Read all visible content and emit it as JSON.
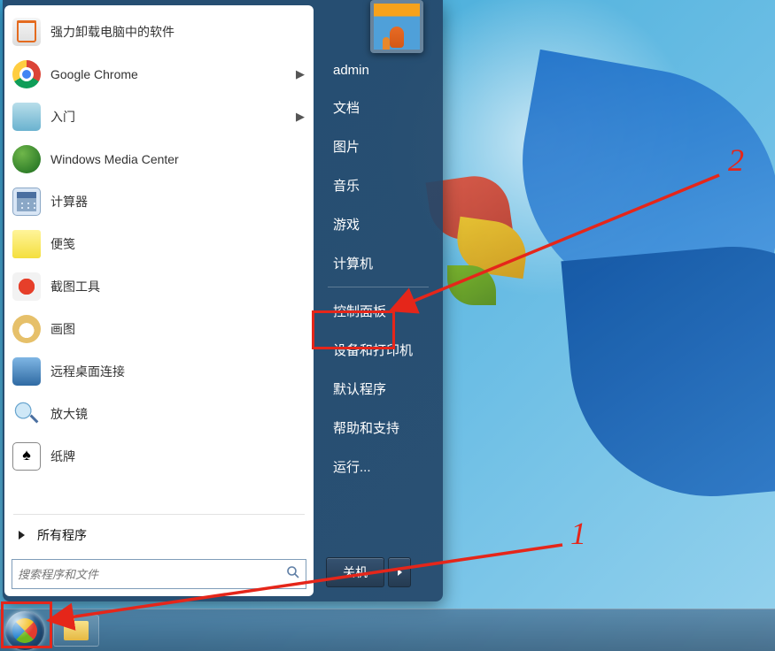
{
  "left": {
    "items": [
      {
        "icon": "uninstall-icon",
        "label": "强力卸载电脑中的软件",
        "hasArrow": false
      },
      {
        "icon": "chrome-icon",
        "label": "Google Chrome",
        "hasArrow": true
      },
      {
        "icon": "getstarted-icon",
        "label": "入门",
        "hasArrow": true
      },
      {
        "icon": "wmc-icon",
        "label": "Windows Media Center",
        "hasArrow": false
      },
      {
        "icon": "calc-icon",
        "label": "计算器",
        "hasArrow": false
      },
      {
        "icon": "sticky-icon",
        "label": "便笺",
        "hasArrow": false
      },
      {
        "icon": "snip-icon",
        "label": "截图工具",
        "hasArrow": false
      },
      {
        "icon": "paint-icon",
        "label": "画图",
        "hasArrow": false
      },
      {
        "icon": "rdp-icon",
        "label": "远程桌面连接",
        "hasArrow": false
      },
      {
        "icon": "magnifier-icon",
        "label": "放大镜",
        "hasArrow": false
      },
      {
        "icon": "solitaire-icon",
        "label": "纸牌",
        "hasArrow": false
      }
    ],
    "allPrograms": "所有程序",
    "searchPlaceholder": "搜索程序和文件"
  },
  "right": {
    "user": "admin",
    "items": [
      "文档",
      "图片",
      "音乐",
      "游戏",
      "计算机"
    ],
    "controlPanel": "控制面板",
    "items2": [
      "设备和打印机",
      "默认程序",
      "帮助和支持",
      "运行..."
    ],
    "shutdown": "关机"
  },
  "annotations": {
    "label1": "1",
    "label2": "2"
  }
}
